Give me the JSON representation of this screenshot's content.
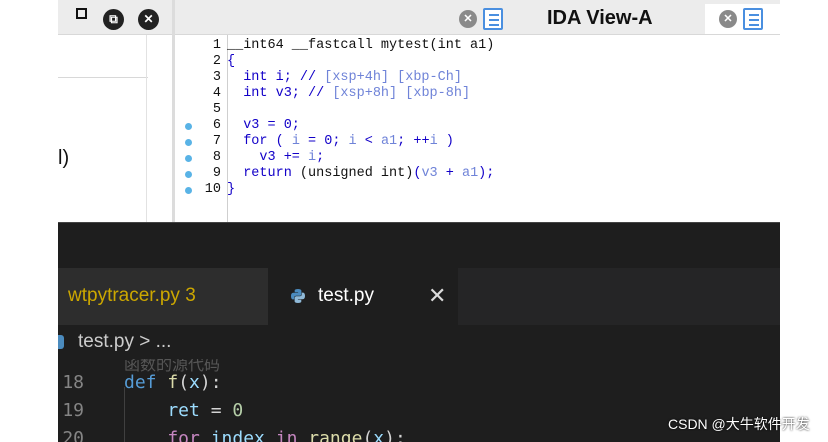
{
  "ida": {
    "left_pane_fragment": "l)",
    "tabs": [
      {
        "label": "IDA View-A",
        "close_glyph": "✕"
      },
      {
        "label": "",
        "close_glyph": "✕"
      }
    ],
    "window_buttons": {
      "restore_glyph": "⧉",
      "close_glyph": "✕"
    },
    "pseudocode": [
      {
        "num": "1",
        "bp": false,
        "tokens": [
          {
            "t": "__int64 __fastcall mytest(int a1)",
            "c": "c-black"
          }
        ]
      },
      {
        "num": "2",
        "bp": false,
        "tokens": [
          {
            "t": "{",
            "c": "c-blue"
          }
        ]
      },
      {
        "num": "3",
        "bp": false,
        "tokens": [
          {
            "t": "  int i; // ",
            "c": "c-blue"
          },
          {
            "t": "[xsp+4h] [xbp-Ch]",
            "c": "c-light"
          }
        ]
      },
      {
        "num": "4",
        "bp": false,
        "tokens": [
          {
            "t": "  int v3; // ",
            "c": "c-blue"
          },
          {
            "t": "[xsp+8h] [xbp-8h]",
            "c": "c-light"
          }
        ]
      },
      {
        "num": "5",
        "bp": false,
        "tokens": []
      },
      {
        "num": "6",
        "bp": true,
        "tokens": [
          {
            "t": "  v3 = 0;",
            "c": "c-blue"
          }
        ]
      },
      {
        "num": "7",
        "bp": true,
        "tokens": [
          {
            "t": "  for ( ",
            "c": "c-blue"
          },
          {
            "t": "i",
            "c": "c-light"
          },
          {
            "t": " = 0; ",
            "c": "c-blue"
          },
          {
            "t": "i",
            "c": "c-light"
          },
          {
            "t": " < ",
            "c": "c-blue"
          },
          {
            "t": "a1",
            "c": "c-light"
          },
          {
            "t": "; ++",
            "c": "c-blue"
          },
          {
            "t": "i",
            "c": "c-light"
          },
          {
            "t": " )",
            "c": "c-blue"
          }
        ]
      },
      {
        "num": "8",
        "bp": true,
        "tokens": [
          {
            "t": "    v3 += ",
            "c": "c-blue"
          },
          {
            "t": "i",
            "c": "c-light"
          },
          {
            "t": ";",
            "c": "c-blue"
          }
        ]
      },
      {
        "num": "9",
        "bp": true,
        "tokens": [
          {
            "t": "  return ",
            "c": "c-blue"
          },
          {
            "t": "(unsigned int)",
            "c": "c-black"
          },
          {
            "t": "(",
            "c": "c-blue"
          },
          {
            "t": "v3",
            "c": "c-light"
          },
          {
            "t": " + ",
            "c": "c-blue"
          },
          {
            "t": "a1",
            "c": "c-light"
          },
          {
            "t": ");",
            "c": "c-blue"
          }
        ]
      },
      {
        "num": "10",
        "bp": true,
        "tokens": [
          {
            "t": "}",
            "c": "c-blue"
          }
        ]
      }
    ]
  },
  "vscode": {
    "tabs": [
      {
        "label": "wtpytracer.py 3"
      },
      {
        "label": "test.py",
        "close_glyph": "✕"
      }
    ],
    "breadcrumb": "test.py > ...",
    "shadow_text": "函数的源代码",
    "lines": [
      {
        "num": "18",
        "tokens": [
          {
            "t": "def ",
            "c": "k-def"
          },
          {
            "t": "f",
            "c": "k-fn"
          },
          {
            "t": "(",
            "c": "k-plain"
          },
          {
            "t": "x",
            "c": "k-param"
          },
          {
            "t": "):",
            "c": "k-plain"
          }
        ]
      },
      {
        "num": "19",
        "tokens": [
          {
            "t": "    ret",
            "c": "k-param"
          },
          {
            "t": " = ",
            "c": "k-plain"
          },
          {
            "t": "0",
            "c": "k-num"
          }
        ]
      },
      {
        "num": "20",
        "tokens": [
          {
            "t": "    for ",
            "c": "k-ctrl"
          },
          {
            "t": "index",
            "c": "k-param"
          },
          {
            "t": " in ",
            "c": "k-ctrl"
          },
          {
            "t": "range",
            "c": "k-fn"
          },
          {
            "t": "(",
            "c": "k-plain"
          },
          {
            "t": "x",
            "c": "k-param"
          },
          {
            "t": "):",
            "c": "k-plain"
          }
        ]
      }
    ]
  },
  "watermark": "CSDN @大牛软件开发"
}
